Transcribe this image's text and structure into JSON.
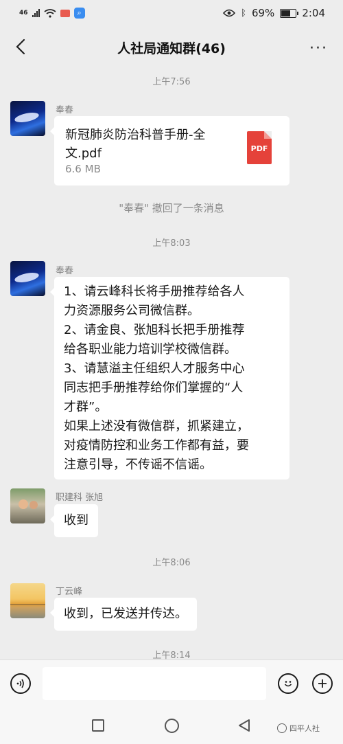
{
  "status": {
    "network": "46",
    "battery": "69%",
    "time": "2:04",
    "battery_level": 0.69
  },
  "header": {
    "title": "人社局通知群(46)",
    "more": "···"
  },
  "messages": {
    "t1": "上午7:56",
    "m1": {
      "sender": "奉春",
      "file_name": "新冠肺炎防治科普手册-全文.pdf",
      "file_size": "6.6 MB",
      "file_icon_text": "PDF"
    },
    "recall": "\"奉春\" 撤回了一条消息",
    "t2": "上午8:03",
    "m2": {
      "sender": "奉春",
      "lines": [
        "1、请云峰科长将手册推荐给各人",
        "力资源服务公司微信群。",
        "2、请金良、张旭科长把手册推荐",
        "给各职业能力培训学校微信群。",
        "3、请慧溢主任组织人才服务中心",
        "同志把手册推荐给你们掌握的“人",
        "才群”。",
        "如果上述没有微信群，抓紧建立，",
        "对疫情防控和业务工作都有益，要",
        "注意引导，不传谣不信谣。"
      ]
    },
    "m3": {
      "sender": "职建科  张旭",
      "text": "收到"
    },
    "t3": "上午8:06",
    "m4": {
      "sender": "丁云峰",
      "text": "收到，已发送并传达。"
    },
    "t4": "上午8:14"
  },
  "input": {
    "placeholder": ""
  },
  "watermark": "四平人社"
}
